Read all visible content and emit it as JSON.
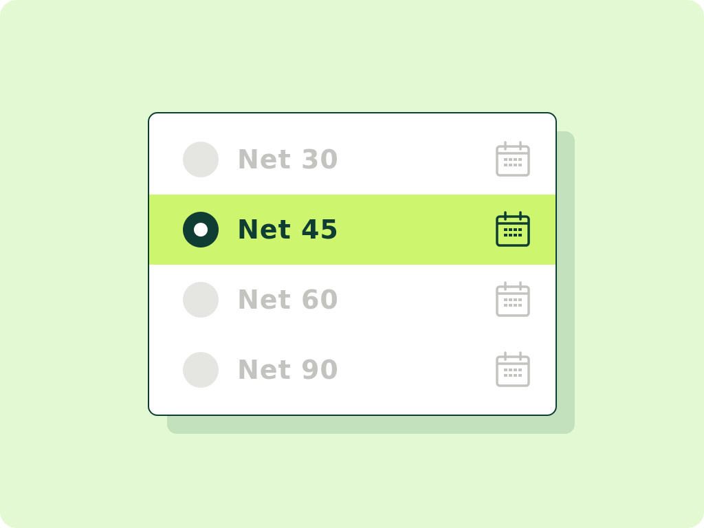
{
  "payment_terms": {
    "options": [
      {
        "label": "Net 30",
        "selected": false,
        "icon": "calendar-icon"
      },
      {
        "label": "Net 45",
        "selected": true,
        "icon": "calendar-icon"
      },
      {
        "label": "Net 60",
        "selected": false,
        "icon": "calendar-icon"
      },
      {
        "label": "Net 90",
        "selected": false,
        "icon": "calendar-icon"
      }
    ]
  },
  "colors": {
    "background": "#e3f9d4",
    "shadow": "#c4e1bd",
    "card_border": "#0f3d33",
    "selected_row": "#cdf56e",
    "selected_text": "#0f3d33",
    "unselected_text": "#c3c3bf",
    "unselected_radio": "#e5e5e2"
  }
}
